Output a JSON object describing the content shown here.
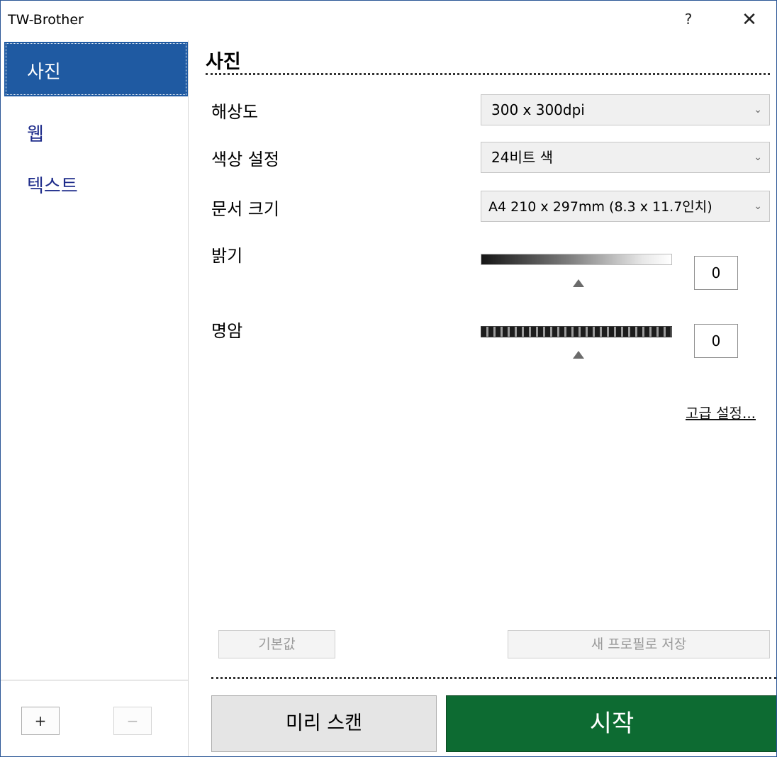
{
  "window": {
    "title": "TW-Brother",
    "help_label": "?",
    "close_label": "✕"
  },
  "sidebar": {
    "items": [
      {
        "label": "사진",
        "selected": true
      },
      {
        "label": "웹",
        "selected": false
      },
      {
        "label": "텍스트",
        "selected": false
      }
    ],
    "add_label": "+",
    "remove_label": "−"
  },
  "main": {
    "heading": "사진",
    "settings": {
      "resolution": {
        "label": "해상도",
        "value": "300 x 300dpi"
      },
      "color": {
        "label": "색상 설정",
        "value": "24비트 색"
      },
      "docsize": {
        "label": "문서 크기",
        "value": "A4 210 x 297mm (8.3 x 11.7인치)"
      },
      "brightness": {
        "label": "밝기",
        "value": "0"
      },
      "contrast": {
        "label": "명암",
        "value": "0"
      }
    },
    "advanced_link": "고급 설정...",
    "default_button": "기본값",
    "save_profile_button": "새 프로필로 저장",
    "prescan_button": "미리 스캔",
    "start_button": "시작"
  },
  "colors": {
    "accent": "#1f5aa2",
    "start_button": "#0d6b32",
    "sidebar_text": "#1d2b8a"
  },
  "icons": {
    "chevron": "chevron-down-icon",
    "thumb": "slider-thumb-icon"
  }
}
